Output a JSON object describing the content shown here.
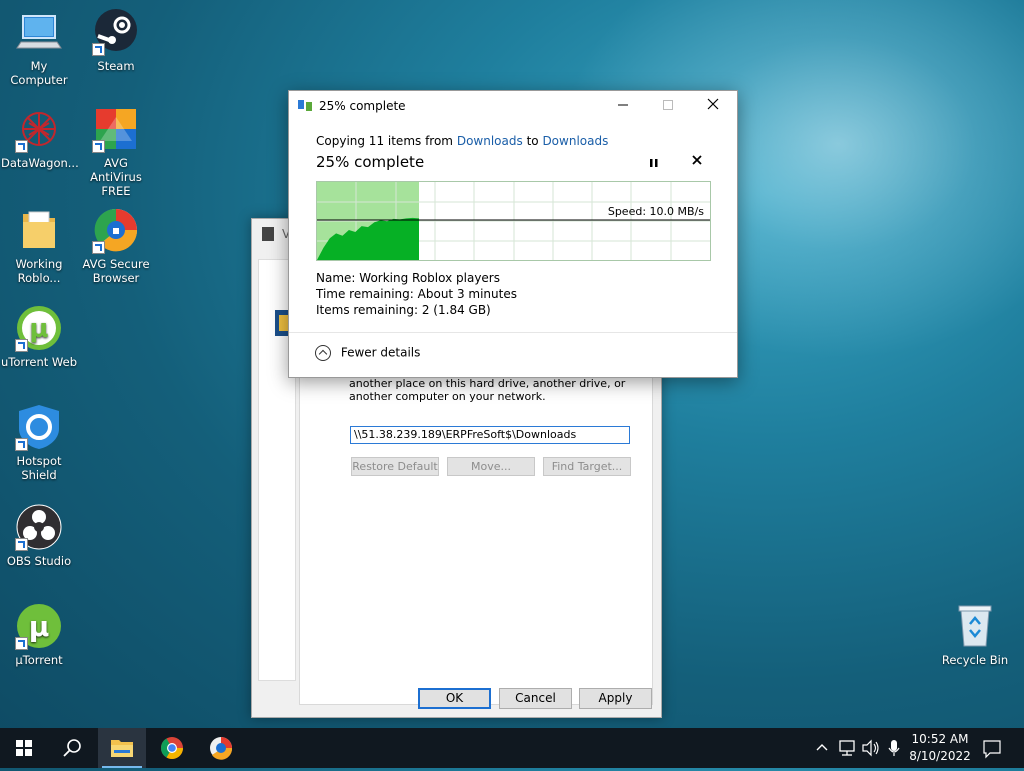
{
  "desktop": {
    "icons": [
      {
        "label": "My Computer",
        "icon": "computer-icon"
      },
      {
        "label": "Steam",
        "icon": "steam-icon"
      },
      {
        "label": "DataWagon...",
        "icon": "datawagon-icon"
      },
      {
        "label": "AVG AntiVirus FREE",
        "icon": "avg-antivirus-icon"
      },
      {
        "label": "Working Roblo...",
        "icon": "folder-icon"
      },
      {
        "label": "AVG Secure Browser",
        "icon": "avg-browser-icon"
      },
      {
        "label": "uTorrent Web",
        "icon": "utorrent-web-icon"
      },
      {
        "label": "Hotspot Shield",
        "icon": "hotspot-shield-icon"
      },
      {
        "label": "OBS Studio",
        "icon": "obs-icon"
      },
      {
        "label": "µTorrent",
        "icon": "utorrent-icon"
      },
      {
        "label": "Recycle Bin",
        "icon": "recycle-bin-icon"
      }
    ]
  },
  "properties_window": {
    "title_partial": "V",
    "description": "another place on this hard drive, another drive, or another computer on your network.",
    "path_value": "\\\\51.38.239.189\\ERPFreSoft$\\Downloads",
    "buttons": {
      "restore": "Restore Default",
      "move": "Move...",
      "find": "Find Target..."
    },
    "footer": {
      "ok": "OK",
      "cancel": "Cancel",
      "apply": "Apply"
    }
  },
  "copy_dialog": {
    "title": "25% complete",
    "copy_prefix": "Copying 11 items from",
    "source": "Downloads",
    "to_word": "to",
    "destination": "Downloads",
    "progress_label": "25% complete",
    "progress_fraction": 0.25,
    "speed": "Speed: 10.0 MB/s",
    "name_label": "Name:",
    "name_value": "Working Roblox players",
    "time_label": "Time remaining:",
    "time_value": "About 3 minutes",
    "items_label": "Items remaining:",
    "items_value": "2 (1.84 GB)",
    "fewer_details": "Fewer details",
    "colors": {
      "graph_fill": "#06b025",
      "graph_done_bg": "#a6e29b",
      "link": "#1a5ea8"
    }
  },
  "taskbar": {
    "time": "10:52 AM",
    "date": "8/10/2022"
  }
}
